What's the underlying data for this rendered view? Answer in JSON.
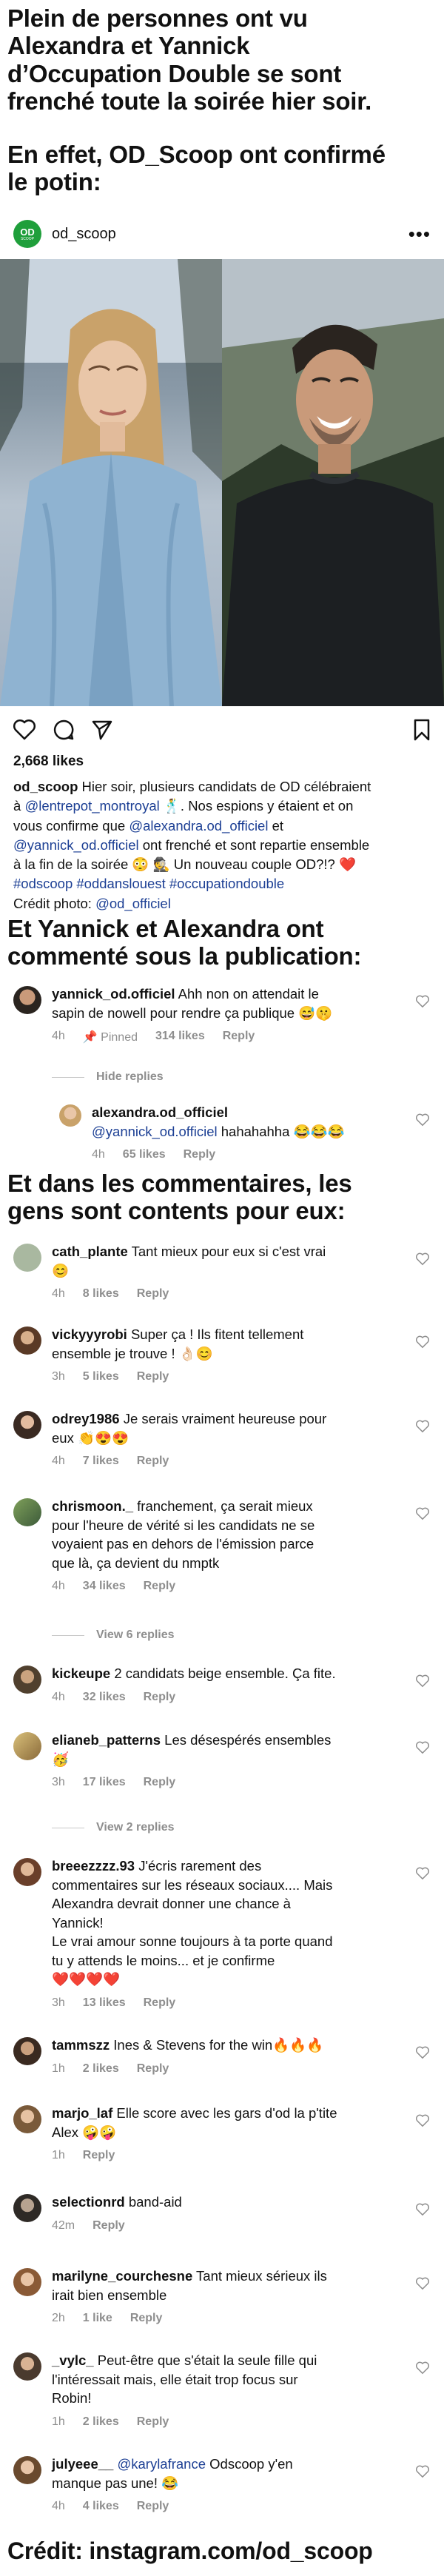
{
  "headline1": [
    "Plein de personnes ont vu",
    "Alexandra et Yannick",
    "d’Occupation Double se sont",
    "frenché toute la soirée hier soir."
  ],
  "headline2": [
    "En effet, OD_Scoop ont confirmé",
    "le potin:"
  ],
  "post": {
    "avatar_text": "OD",
    "avatar_sub": "SCOOP",
    "username": "od_scoop",
    "more": "•••",
    "likes": "2,668 likes",
    "caption": {
      "user": "od_scoop",
      "l1a": " Hier soir, plusieurs candidats de OD célébraient",
      "l2a": "à ",
      "mention1": "@lentrepot_montroyal",
      "l2b": " 🕺. Nos espions y étaient et on",
      "l3a": "vous confirme que ",
      "mention2": "@alexandra.od_officiel",
      "l3b": " et",
      "mention3": "@yannick_od.officiel",
      "l4b": " ont frenché et sont repartie ensemble",
      "l5": "à la fin de la soirée 😳 🕵️ Un nouveau couple OD?!? ❤️",
      "hashtags": "#odscoop #oddanslouest #occupationdouble",
      "credit_label": "Crédit photo: ",
      "credit_user": "@od_officiel"
    }
  },
  "headline3": [
    "Et Yannick et Alexandra ont",
    "commenté sous la publication:"
  ],
  "headline4": [
    "Et dans les commentaires, les",
    "gens sont contents pour eux:"
  ],
  "headline5": "Crédit: instagram.com/od_scoop",
  "comments_top": [
    {
      "user": "yannick_od.officiel",
      "l1": " Ahh non on attendait le",
      "l2": "sapin de nowell pour rendre ça publique 😅🤫",
      "time": "4h",
      "pinned": "📌 Pinned",
      "likes": "314 likes",
      "reply": "Reply"
    }
  ],
  "hide_replies": "Hide replies",
  "reply_alex": {
    "user": "alexandra.od_officiel",
    "mention": "@yannick_od.officiel",
    "text": " hahahahha 😂😂😂",
    "time": "4h",
    "likes": "65 likes",
    "reply": "Reply"
  },
  "comments": [
    {
      "user": "cath_plante",
      "lines": [
        "Tant mieux pour eux si c'est vrai",
        "😊"
      ],
      "time": "4h",
      "likes": "8 likes",
      "reply": "Reply"
    },
    {
      "user": "vickyyyrobi",
      "lines": [
        "Super ça ! Ils fitent tellement",
        "ensemble je trouve ! 👌🏻😊"
      ],
      "time": "3h",
      "likes": "5 likes",
      "reply": "Reply"
    },
    {
      "user": "odrey1986",
      "lines": [
        "Je serais vraiment heureuse pour",
        "eux 👏😍😍"
      ],
      "time": "4h",
      "likes": "7 likes",
      "reply": "Reply"
    },
    {
      "user": "chrismoon._",
      "lines": [
        "franchement, ça serait mieux",
        "pour l'heure de vérité si les candidats ne se",
        "voyaient pas en dehors de l'émission parce",
        "que là, ça devient du nmptk"
      ],
      "time": "4h",
      "likes": "34 likes",
      "reply": "Reply"
    },
    {
      "user": "kickeupe",
      "lines": [
        "2 candidats beige ensemble. Ça fite."
      ],
      "time": "4h",
      "likes": "32 likes",
      "reply": "Reply"
    },
    {
      "user": "elianeb_patterns",
      "lines": [
        "Les désespérés ensembles",
        "🥳"
      ],
      "time": "3h",
      "likes": "17 likes",
      "reply": "Reply"
    },
    {
      "user": "breeezzzz.93",
      "lines": [
        "J'écris rarement des",
        "commentaires sur les réseaux sociaux.... Mais",
        "Alexandra devrait donner une chance à",
        "Yannick!",
        "Le vrai amour sonne toujours à ta porte quand",
        "tu y attends le moins... et je confirme",
        "❤️❤️❤️❤️"
      ],
      "time": "3h",
      "likes": "13 likes",
      "reply": "Reply"
    },
    {
      "user": "tammszz",
      "lines": [
        "Ines & Stevens for the win🔥🔥🔥"
      ],
      "time": "1h",
      "likes": "2 likes",
      "reply": "Reply"
    },
    {
      "user": "marjo_laf",
      "lines": [
        "Elle score avec les gars d'od la p'tite",
        "Alex 🤪🤪"
      ],
      "time": "1h",
      "likes": "",
      "reply": "Reply"
    },
    {
      "user": "selectionrd",
      "lines": [
        "band-aid"
      ],
      "time": "42m",
      "likes": "",
      "reply": "Reply"
    },
    {
      "user": "marilyne_courchesne",
      "lines": [
        "Tant mieux sérieux ils",
        "irait bien ensemble"
      ],
      "time": "2h",
      "likes": "1 like",
      "reply": "Reply"
    },
    {
      "user": "_vylc_",
      "lines": [
        "Peut-être que s'était la seule fille qui",
        "l'intéressait mais, elle était trop focus sur",
        "Robin!"
      ],
      "time": "1h",
      "likes": "2 likes",
      "reply": "Reply"
    },
    {
      "user": "julyeee__",
      "mention": "@karylafrance",
      "lines": [
        " Odscoop y'en",
        "manque pas une! 😂"
      ],
      "time": "4h",
      "likes": "4 likes",
      "reply": "Reply"
    }
  ],
  "view_replies_1": "View 6 replies",
  "view_replies_2": "View 2 replies",
  "colors": {
    "link": "#1c3f94",
    "meta": "#8e8e8e",
    "od_green": "#1f9f3b",
    "pin_red": "#d13b2f"
  }
}
